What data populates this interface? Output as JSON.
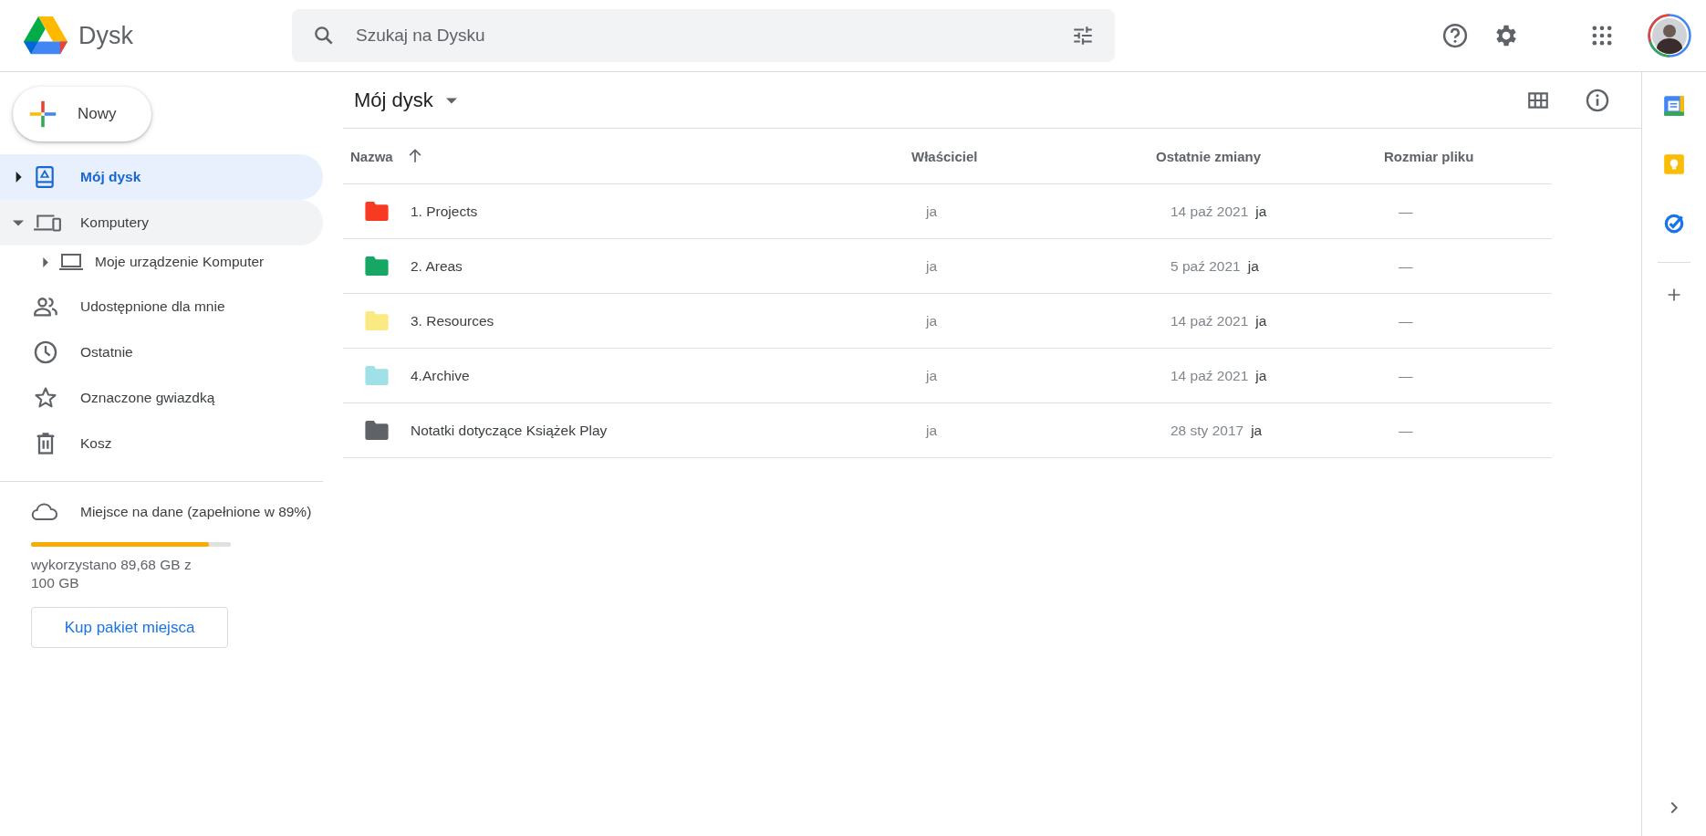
{
  "app": {
    "name": "Dysk"
  },
  "search": {
    "placeholder": "Szukaj na Dysku"
  },
  "new_button": {
    "label": "Nowy"
  },
  "sidebar": {
    "items": [
      {
        "kind": "drive",
        "label": "Mój dysk",
        "selected": true,
        "expanded": false
      },
      {
        "kind": "computers",
        "label": "Komputery",
        "selected": false,
        "hovered": true,
        "expanded": true,
        "children": [
          {
            "kind": "laptop",
            "label": "Moje urządzenie Komputer",
            "expanded": false
          }
        ]
      },
      {
        "kind": "shared",
        "label": "Udostępnione dla mnie",
        "selected": false
      },
      {
        "kind": "recent",
        "label": "Ostatnie",
        "selected": false
      },
      {
        "kind": "starred",
        "label": "Oznaczone gwiazdką",
        "selected": false
      },
      {
        "kind": "trash",
        "label": "Kosz",
        "selected": false
      }
    ]
  },
  "storage": {
    "label": "Miejsce na dane (zapełnione w 89%)",
    "level": 0.89,
    "usage": "wykorzystano 89,68 GB z 100 GB",
    "button": "Kup pakiet miejsca"
  },
  "breadcrumb": {
    "title": "Mój dysk"
  },
  "table": {
    "columns": [
      "Nazwa",
      "Właściciel",
      "Ostatnie zmiany",
      "Rozmiar pliku"
    ],
    "rows": [
      {
        "name": "1. Projects",
        "color": "#f83a22",
        "owner": "ja",
        "modified": "14 paź 2021",
        "modified_by": "ja",
        "size": "—"
      },
      {
        "name": "2. Areas",
        "color": "#16a765",
        "owner": "ja",
        "modified": "5 paź 2021",
        "modified_by": "ja",
        "size": "—"
      },
      {
        "name": "3. Resources",
        "color": "#fbe983",
        "owner": "ja",
        "modified": "14 paź 2021",
        "modified_by": "ja",
        "size": "—"
      },
      {
        "name": "4.Archive",
        "color": "#9fe1e7",
        "owner": "ja",
        "modified": "14 paź 2021",
        "modified_by": "ja",
        "size": "—"
      },
      {
        "name": "Notatki dotyczące Książek Play",
        "color": "#5f6368",
        "owner": "ja",
        "modified": "28 sty 2017",
        "modified_by": "ja",
        "size": "—"
      }
    ]
  }
}
